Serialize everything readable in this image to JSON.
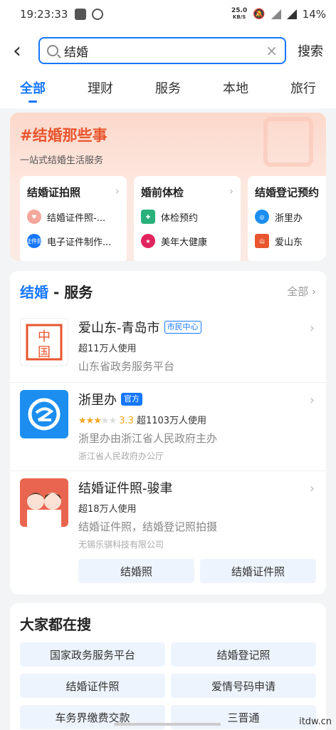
{
  "status": {
    "time": "19:23:33",
    "speed_top": "25.0",
    "speed_unit": "KB/S",
    "battery": "14%"
  },
  "search": {
    "query": "结婚",
    "button": "搜索"
  },
  "tabs": [
    "全部",
    "理财",
    "服务",
    "本地",
    "旅行"
  ],
  "banner": {
    "title": "#结婚那些事",
    "subtitle": "一站式结婚生活服务",
    "cards": [
      {
        "title": "结婚证拍照",
        "items": [
          "结婚证件照-...",
          "电子证件制作..."
        ]
      },
      {
        "title": "婚前体检",
        "items": [
          "体检预约",
          "美年大健康"
        ]
      },
      {
        "title": "结婚登记预约",
        "items": [
          "浙里办",
          "爱山东"
        ]
      }
    ]
  },
  "services": {
    "keyword": "结婚",
    "suffix": " - 服务",
    "all_label": "全部",
    "items": [
      {
        "name": "爱山东-青岛市",
        "tag": "市民中心",
        "users": "超11万人使用",
        "desc": "山东省政务服务平台",
        "org": ""
      },
      {
        "name": "浙里办",
        "tag": "官方",
        "rating": "3.3",
        "users": "超1103万人使用",
        "desc": "浙里办由浙江省人民政府主办",
        "org": "浙江省人民政府办公厅"
      },
      {
        "name": "结婚证件照-骏聿",
        "tag": "",
        "users": "超18万人使用",
        "desc": "结婚证件照，结婚登记照拍摄",
        "org": "无锡乐骐科技有限公司"
      }
    ],
    "buttons": [
      "结婚照",
      "结婚证件照"
    ]
  },
  "hot": {
    "title": "大家都在搜",
    "items": [
      "国家政务服务平台",
      "结婚登记照",
      "结婚证件照",
      "爱情号码申请",
      "车务界缴费交款",
      "三晋通"
    ]
  },
  "logos": {
    "ashandong_text": "爱山东",
    "zheli_text": "浙里办",
    "card_doc_text": "证件照"
  },
  "watermark": "itdw.cn",
  "colors": {
    "accent": "#1677ff",
    "banner_title": "#e8552e",
    "star": "#f5a623"
  }
}
